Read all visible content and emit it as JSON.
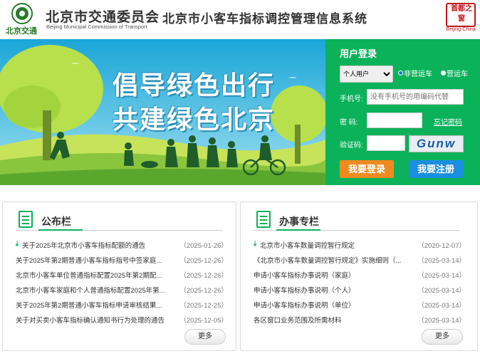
{
  "header": {
    "logo_text": "北京交通",
    "org_cn": "北京市交通委员会",
    "org_en": "Beijing Municipal Commission of Transport",
    "system_title": "北京市小客车指标调控管理信息系统",
    "seal_chars": "首都之窗",
    "seal_en": "Beijing-China"
  },
  "banner": {
    "slogan_line1": "倡导绿色出行",
    "slogan_line2": "共建绿色北京"
  },
  "login": {
    "title": "用户登录",
    "user_type_selected": "个人用户",
    "radio_non_commercial": "非营运车",
    "radio_commercial": "营运车",
    "phone_label": "手机号:",
    "phone_placeholder": "没有手机号的用编码代替",
    "password_label": "密  码:",
    "forgot_link": "忘记密码",
    "captcha_label": "验证码:",
    "captcha_text": "Gunw",
    "login_button": "我要登录",
    "register_button": "我要注册"
  },
  "notice": {
    "title": "公布栏",
    "more": "更多",
    "items": [
      {
        "text": "关于2025年北京市小客车指标配额的通告",
        "date": "（2025-01-26）",
        "pinned": true
      },
      {
        "text": "关于2025年第2期普通小客车指标指号中签家庭...",
        "date": "（2025-12-26）",
        "pinned": false
      },
      {
        "text": "北京市小客车单位普通指标配置2025年第2期配...",
        "date": "（2025-12-26）",
        "pinned": false
      },
      {
        "text": "北京市小客车家庭和个人普通指标配置2025年第...",
        "date": "（2025-12-26）",
        "pinned": false
      },
      {
        "text": "关于2025年第2期普通小客车指标申请审核结果...",
        "date": "（2025-12-25）",
        "pinned": false
      },
      {
        "text": "关于对买卖小客车指标确认通知书行为处理的通告",
        "date": "（2025-12-05）",
        "pinned": false
      }
    ]
  },
  "service": {
    "title": "办事专栏",
    "more": "更多",
    "items": [
      {
        "text": "北京市小客车数量调控暂行规定",
        "date": "（2020-12-07）",
        "pinned": true
      },
      {
        "text": "《北京市小客车数量调控暂行规定》实施细则（...",
        "date": "（2025-03-14）",
        "pinned": false
      },
      {
        "text": "申请小客车指标办事说明（家庭）",
        "date": "（2025-03-14）",
        "pinned": false
      },
      {
        "text": "申请小客车指标办事说明（个人）",
        "date": "（2025-03-14）",
        "pinned": false
      },
      {
        "text": "申请小客车指标办事说明（单位）",
        "date": "（2025-03-14）",
        "pinned": false
      },
      {
        "text": "各区窗口业务范围及所需材料",
        "date": "（2025-03-14）",
        "pinned": false
      }
    ]
  },
  "colors": {
    "brand_green": "#0bb25a",
    "login_orange": "#f08a1f",
    "register_blue": "#1a8ee0"
  }
}
